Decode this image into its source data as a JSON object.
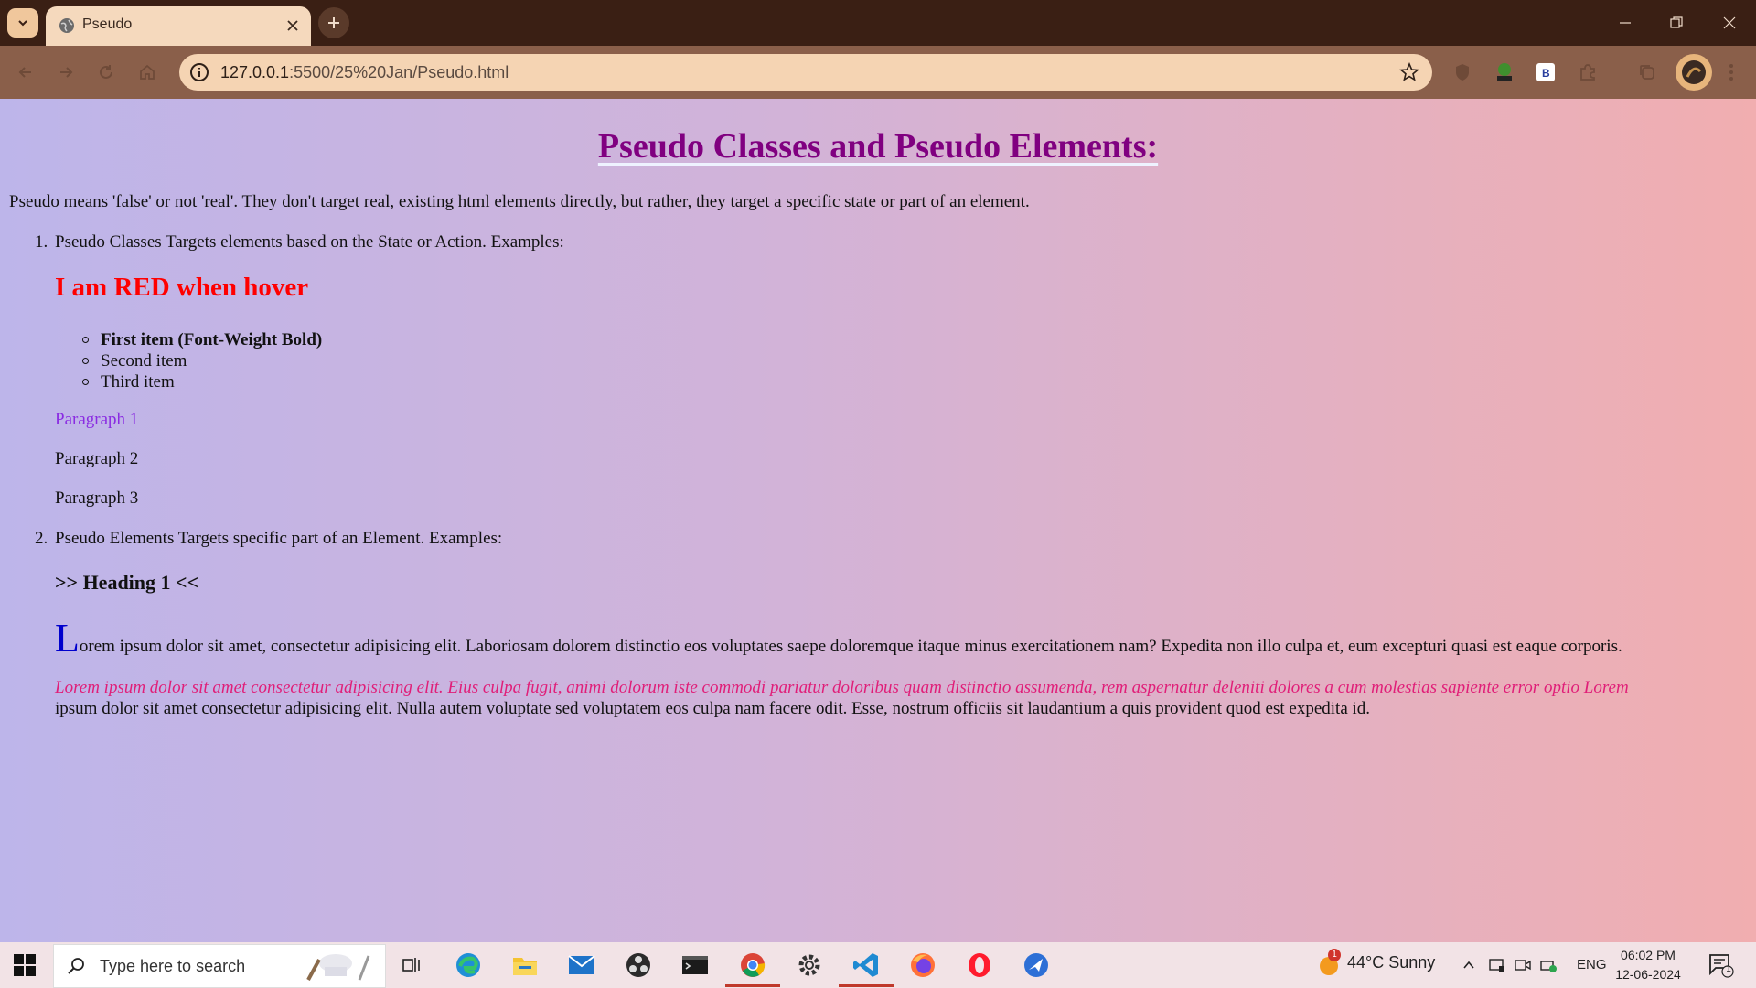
{
  "browser": {
    "tab_title": "Pseudo",
    "url_host": "127.0.0.1",
    "url_rest": ":5500/25%20Jan/Pseudo.html"
  },
  "page": {
    "title": "Pseudo Classes and Pseudo Elements:",
    "intro": "Pseudo means 'false' or not 'real'. They don't target real, existing html elements directly, but rather, they target a specific state or part of an element.",
    "item1_num": "1.",
    "item1_text": "Pseudo Classes Targets elements based on the State or Action. Examples:",
    "hover_heading": "I am RED when hover",
    "bullets": [
      "First item (Font-Weight Bold)",
      "Second item",
      "Third item"
    ],
    "paragraphs": [
      "Paragraph 1",
      "Paragraph 2",
      "Paragraph 3"
    ],
    "item2_num": "2.",
    "item2_text": "Pseudo Elements Targets specific part of an Element. Examples:",
    "sub_heading": ">> Heading 1 <<",
    "lorem1_dropcap": "L",
    "lorem1_rest": "orem ipsum dolor sit amet, consectetur adipisicing elit. Laboriosam dolorem distinctio eos voluptates saepe doloremque itaque minus exercitationem nam? Expedita non illo culpa et, eum excepturi quasi est eaque corporis.",
    "lorem2_firstline": "Lorem ipsum dolor sit amet consectetur adipisicing elit. Eius culpa fugit, animi dolorum iste commodi pariatur doloribus quam distinctio assumenda, rem aspernatur deleniti dolores a cum molestias sapiente error optio Lorem",
    "lorem2_rest": "ipsum dolor sit amet consectetur adipisicing elit. Nulla autem voluptate sed voluptatem eos culpa nam facere odit. Esse, nostrum officiis sit laudantium a quis provident quod est expedita id."
  },
  "taskbar": {
    "search_placeholder": "Type here to search",
    "weather": "44°C  Sunny",
    "weather_badge": "1",
    "lang": "ENG",
    "time": "06:02 PM",
    "date": "12-06-2024",
    "notification_count": "1"
  },
  "colors": {
    "title": "#800080",
    "hover_heading": "#ff0000",
    "paragraph1": "#8a2be2",
    "dropcap": "#0000cd",
    "firstline": "#e01e78"
  }
}
